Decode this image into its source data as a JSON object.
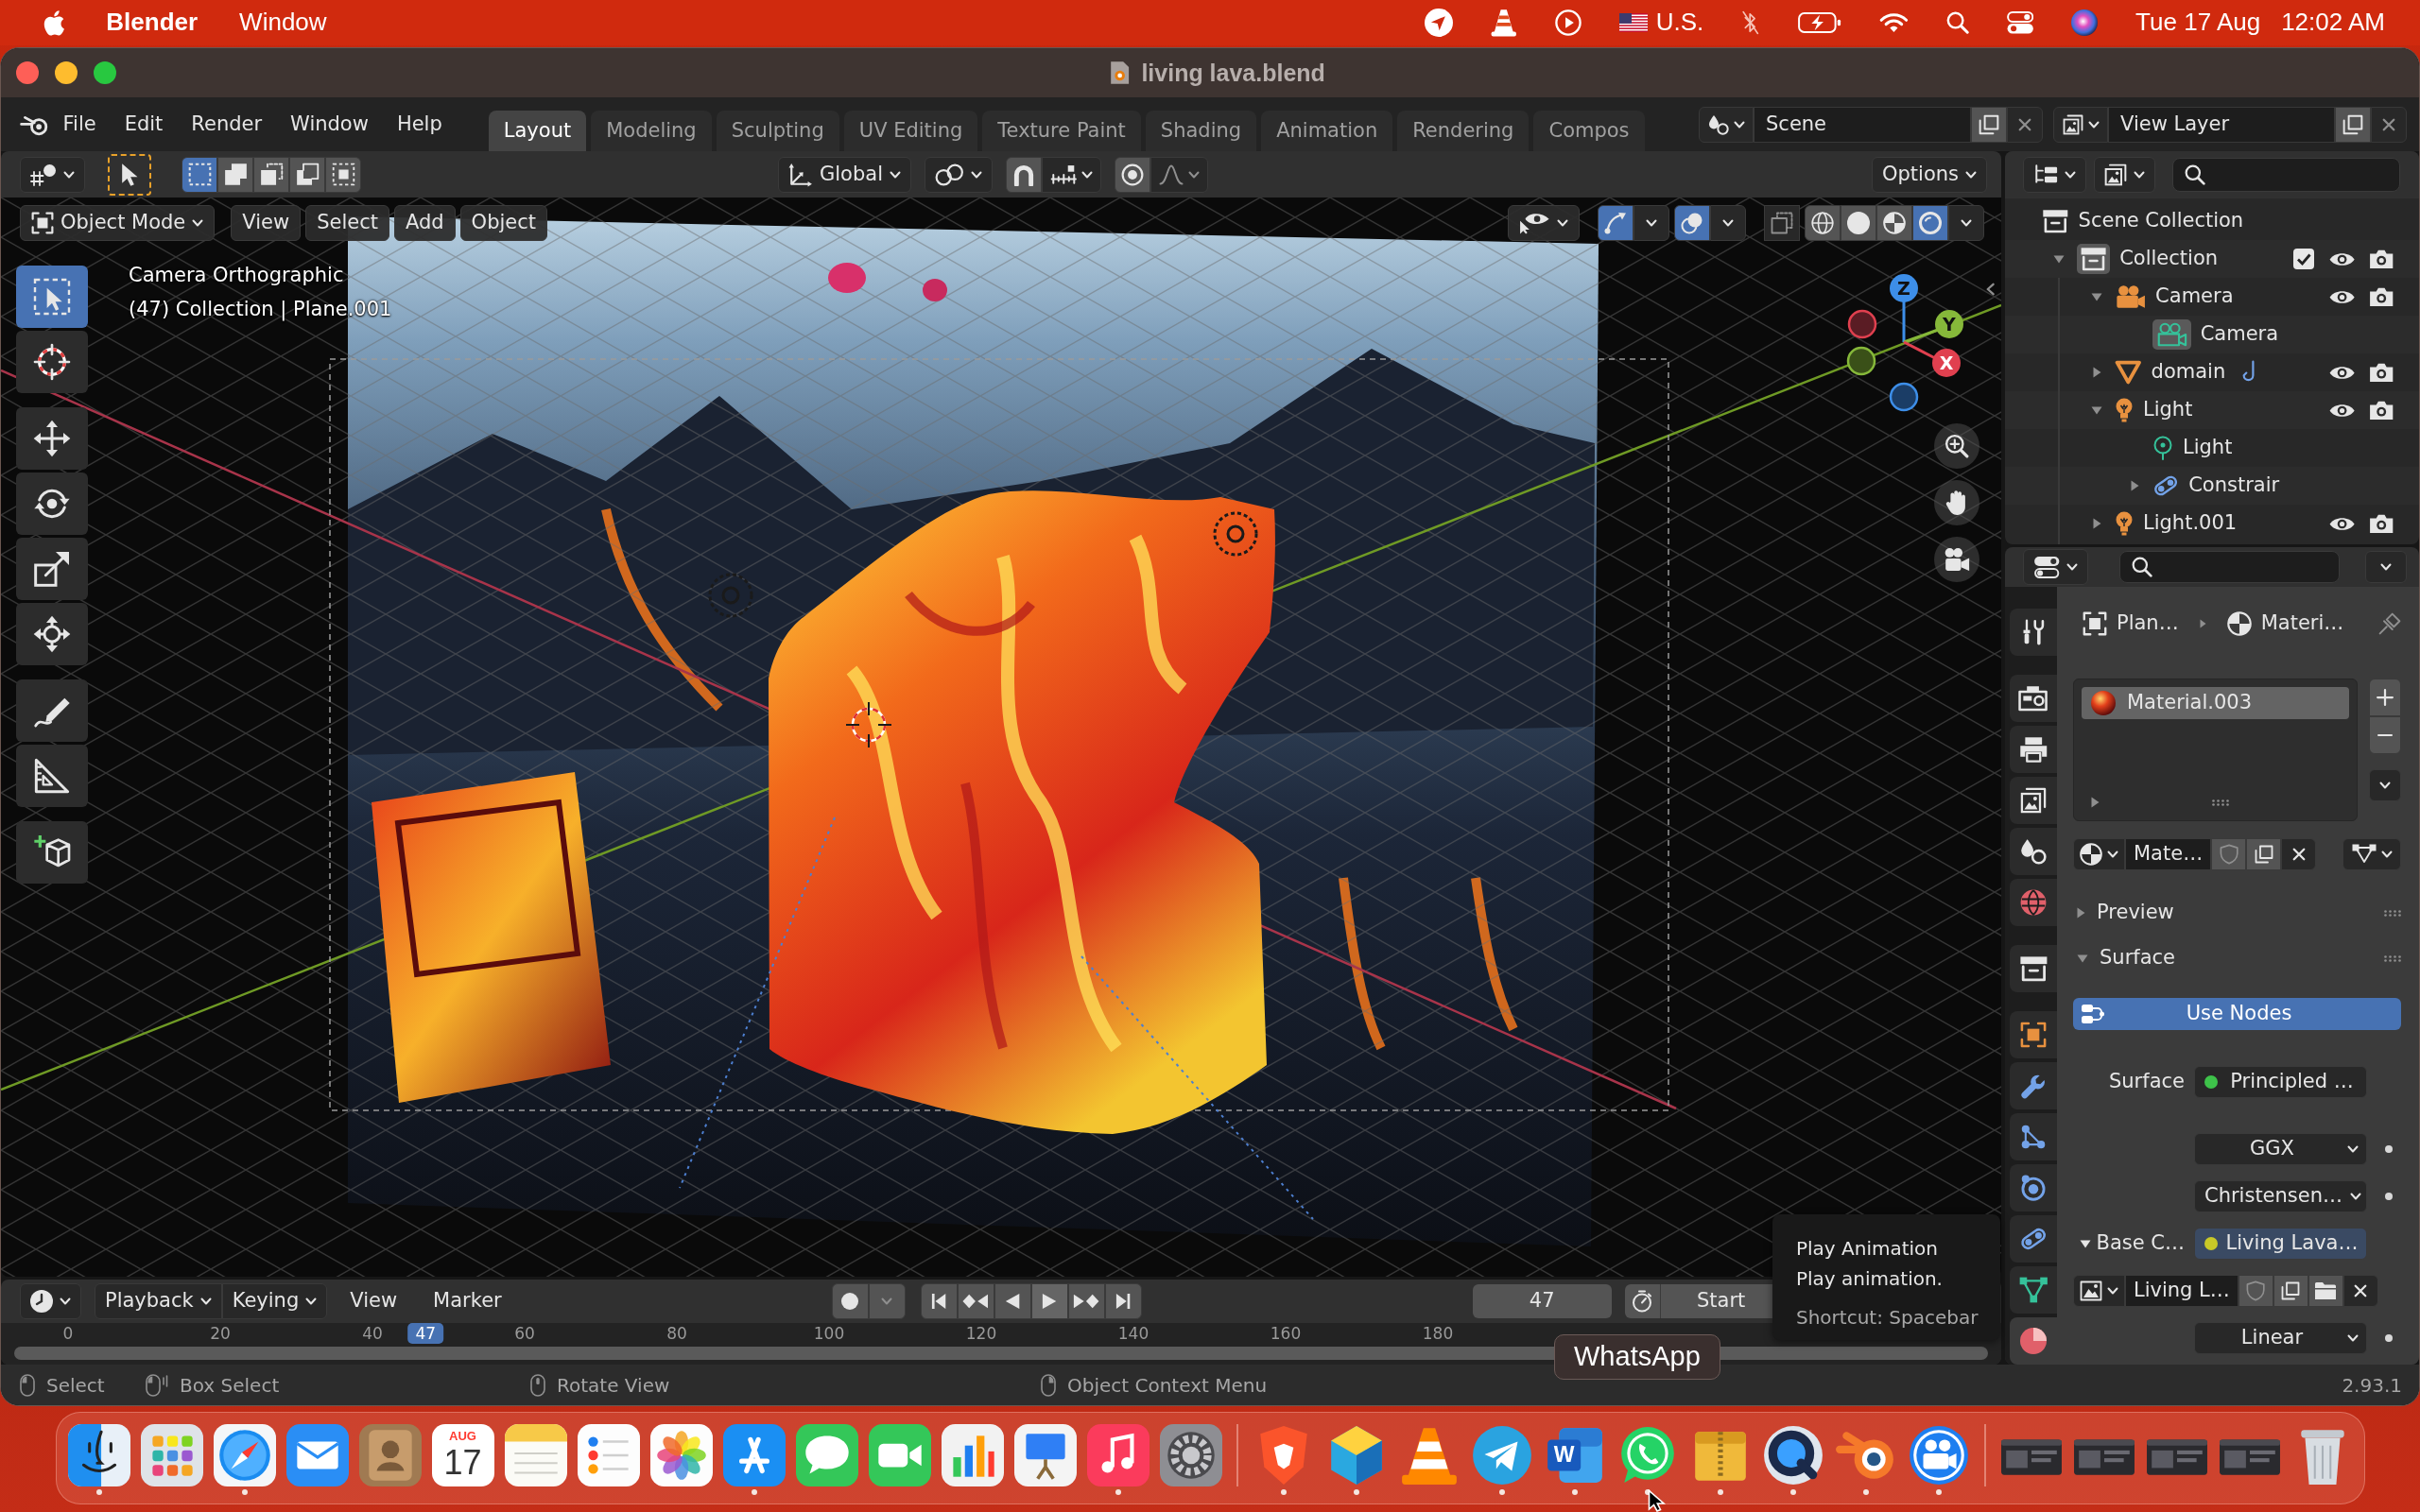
{
  "menu_bar": {
    "app": "Blender",
    "menus": [
      "Window"
    ],
    "input_source": "U.S.",
    "date": "Tue 17 Aug",
    "time": "12:02 AM"
  },
  "window": {
    "title": "living lava.blend"
  },
  "top_bar": {
    "menus": [
      "File",
      "Edit",
      "Render",
      "Window",
      "Help"
    ],
    "workspaces": [
      {
        "label": "Layout",
        "selected": true
      },
      {
        "label": "Modeling",
        "selected": false
      },
      {
        "label": "Sculpting",
        "selected": false
      },
      {
        "label": "UV Editing",
        "selected": false
      },
      {
        "label": "Texture Paint",
        "selected": false
      },
      {
        "label": "Shading",
        "selected": false
      },
      {
        "label": "Animation",
        "selected": false
      },
      {
        "label": "Rendering",
        "selected": false
      },
      {
        "label": "Compos",
        "selected": false
      }
    ],
    "scene": "Scene",
    "view_layer": "View Layer"
  },
  "tool_header": {
    "select_modes": [
      {
        "selected": true
      },
      {
        "selected": false
      },
      {
        "selected": false
      },
      {
        "selected": false
      },
      {
        "selected": false
      }
    ],
    "orientation": "Global",
    "options": "Options"
  },
  "viewport": {
    "mode": "Object Mode",
    "menus": [
      "View",
      "Select",
      "Add",
      "Object"
    ],
    "gizmos": {
      "on": true
    },
    "overlays": {
      "on": true
    },
    "xray": {
      "on": false
    },
    "shading": [
      {
        "kind": "wireframe",
        "selected": false
      },
      {
        "kind": "solid",
        "selected": false
      },
      {
        "kind": "material",
        "selected": false
      },
      {
        "kind": "rendered",
        "selected": true
      }
    ],
    "overlay_text": [
      "Camera Orthographic",
      "(47) Collection | Plane.001"
    ],
    "tool_groups": [
      {
        "tools": [
          {
            "kind": "select_box",
            "selected": true
          },
          {
            "kind": "cursor",
            "selected": false
          }
        ]
      },
      {
        "tools": [
          {
            "kind": "move",
            "selected": false
          },
          {
            "kind": "rotate",
            "selected": false
          },
          {
            "kind": "scale",
            "selected": false
          },
          {
            "kind": "transform",
            "selected": false
          }
        ]
      },
      {
        "tools": [
          {
            "kind": "annotate",
            "selected": false
          },
          {
            "kind": "measure",
            "selected": false
          }
        ]
      },
      {
        "tools": [
          {
            "kind": "add_cube",
            "selected": false
          }
        ]
      }
    ],
    "gizmo": {
      "x": "X",
      "y": "Y",
      "z": "Z"
    }
  },
  "outliner": {
    "items": [
      {
        "label": "Scene Collection",
        "kind": "scene_collection",
        "active": false,
        "children": [
          {
            "label": "Collection",
            "kind": "collection",
            "expanded": true,
            "active": true,
            "checked": true,
            "visible": true,
            "renderable": true,
            "children": [
              {
                "label": "Camera",
                "kind": "camera",
                "expanded": true,
                "active": false,
                "visible": true,
                "renderable": true,
                "children": [
                  {
                    "label": "Camera",
                    "kind": "camera_data",
                    "active": true
                  }
                ]
              },
              {
                "label": "domain",
                "kind": "mesh",
                "expanded": false,
                "active": false,
                "visible": true,
                "renderable": true,
                "inline": [
                  {
                    "kind": "hook"
                  }
                ]
              },
              {
                "label": "Light",
                "kind": "light",
                "expanded": true,
                "active": false,
                "visible": true,
                "renderable": true,
                "children": [
                  {
                    "label": "Light",
                    "kind": "light_data",
                    "active": false
                  },
                  {
                    "label": "Constrair",
                    "kind": "constraint",
                    "expanded": false,
                    "active": false
                  }
                ]
              },
              {
                "label": "Light.001",
                "kind": "light",
                "expanded": false,
                "active": false,
                "visible": true,
                "renderable": true
              }
            ]
          }
        ]
      }
    ]
  },
  "properties": {
    "tab_groups": [
      {
        "tabs": [
          {
            "kind": "tool",
            "selected": false
          }
        ]
      },
      {
        "tabs": [
          {
            "kind": "render",
            "selected": false
          },
          {
            "kind": "output",
            "selected": false
          },
          {
            "kind": "view_layer",
            "selected": false
          },
          {
            "kind": "scene",
            "selected": false
          },
          {
            "kind": "world",
            "selected": false
          }
        ]
      },
      {
        "tabs": [
          {
            "kind": "collection",
            "selected": false
          }
        ]
      },
      {
        "tabs": [
          {
            "kind": "object",
            "selected": false
          },
          {
            "kind": "modifiers",
            "selected": false
          },
          {
            "kind": "particles",
            "selected": false
          },
          {
            "kind": "physics",
            "selected": false
          },
          {
            "kind": "constraints",
            "selected": false
          },
          {
            "kind": "data",
            "selected": false
          },
          {
            "kind": "material",
            "selected": true
          }
        ]
      }
    ],
    "breadcrumb": [
      {
        "kind": "object",
        "label": "Plan…"
      },
      {
        "kind": "material",
        "label": "Materi…"
      }
    ],
    "material_slots": [
      {
        "label": "Material.003",
        "selected": true
      }
    ],
    "material": "Mate…",
    "panels": [
      {
        "label": "Preview",
        "expanded": false
      },
      {
        "label": "Surface",
        "expanded": true,
        "use_nodes": "Use Nodes",
        "rows": [
          {
            "kind": "link",
            "label": "Surface",
            "value": "Principled …",
            "color": "#3ec24a"
          },
          {
            "kind": "dropdown",
            "value": "GGX"
          },
          {
            "kind": "dropdown",
            "value": "Christensen…"
          },
          {
            "kind": "link",
            "label": "Base C…",
            "value": "Living Lava…",
            "color": "#c8c828",
            "expanded": true
          },
          {
            "kind": "image",
            "value": "Living L…"
          },
          {
            "kind": "dropdown",
            "value": "Linear"
          }
        ]
      }
    ]
  },
  "timeline": {
    "menus": [
      {
        "label": "Playback",
        "kind": "dropdown"
      },
      {
        "label": "Keying",
        "kind": "dropdown"
      },
      {
        "label": "View",
        "kind": "menu"
      },
      {
        "label": "Marker",
        "kind": "menu"
      }
    ],
    "current_frame": "47",
    "start_label": "Start",
    "ruler": [
      "0",
      "20",
      "40",
      "60",
      "80",
      "100",
      "120",
      "140",
      "160",
      "180"
    ],
    "frame_marker": "47"
  },
  "tooltip": {
    "title": "Play Animation",
    "description": "Play animation.",
    "shortcut": "Shortcut: Spacebar"
  },
  "status_bar": {
    "hints": [
      {
        "kind": "left_click",
        "label": "Select"
      },
      {
        "kind": "left_drag",
        "label": "Box Select"
      },
      {
        "kind": "middle_drag",
        "label": "Rotate View"
      },
      {
        "kind": "right_click",
        "label": "Object Context Menu"
      }
    ],
    "version": "2.93.1"
  },
  "dock": {
    "items": [
      {
        "kind": "app",
        "running": true
      },
      {
        "kind": "app",
        "running": false
      },
      {
        "kind": "app",
        "running": true
      },
      {
        "kind": "app",
        "running": false
      },
      {
        "kind": "app",
        "running": false
      },
      {
        "kind": "calendar",
        "month": "AUG",
        "day": "17",
        "running": false
      },
      {
        "kind": "app",
        "running": false
      },
      {
        "kind": "app",
        "running": false
      },
      {
        "kind": "app",
        "running": false
      },
      {
        "kind": "app",
        "running": true
      },
      {
        "kind": "app",
        "running": false
      },
      {
        "kind": "app",
        "running": false
      },
      {
        "kind": "app",
        "running": false
      },
      {
        "kind": "app",
        "running": false
      },
      {
        "kind": "app",
        "running": true
      },
      {
        "kind": "app",
        "running": false
      },
      {
        "kind": "separator"
      },
      {
        "kind": "app",
        "running": true
      },
      {
        "kind": "app",
        "running": true
      },
      {
        "kind": "app",
        "running": false
      },
      {
        "kind": "app",
        "running": true
      },
      {
        "kind": "app",
        "letter": "W",
        "running": true
      },
      {
        "kind": "app",
        "running": true
      },
      {
        "kind": "app",
        "running": true
      },
      {
        "kind": "app",
        "running": true
      },
      {
        "kind": "app",
        "running": true
      },
      {
        "kind": "app",
        "running": true
      },
      {
        "kind": "separator"
      },
      {
        "kind": "window"
      },
      {
        "kind": "window"
      },
      {
        "kind": "window"
      },
      {
        "kind": "window"
      },
      {
        "kind": "trash"
      }
    ],
    "tooltip": "WhatsApp"
  }
}
